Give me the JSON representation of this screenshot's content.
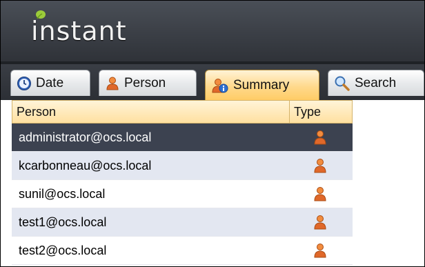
{
  "app": {
    "logo_text": "instant"
  },
  "tabs": [
    {
      "label": "Date",
      "icon": "clock-icon"
    },
    {
      "label": "Person",
      "icon": "person-icon"
    },
    {
      "label": "Summary",
      "icon": "summary-person-info-icon",
      "active": true
    },
    {
      "label": "Search",
      "icon": "search-icon"
    }
  ],
  "table": {
    "headers": {
      "person": "Person",
      "type": "Type"
    },
    "rows": [
      {
        "person": "administrator@ocs.local",
        "type_icon": "person-icon",
        "selected": true
      },
      {
        "person": "kcarbonneau@ocs.local",
        "type_icon": "person-icon"
      },
      {
        "person": "sunil@ocs.local",
        "type_icon": "person-icon"
      },
      {
        "person": "test1@ocs.local",
        "type_icon": "person-icon"
      },
      {
        "person": "test2@ocs.local",
        "type_icon": "person-icon"
      }
    ]
  },
  "colors": {
    "header_bg": "#3a3e45",
    "active_tab": "#ffcc66",
    "selected_row": "#3c4250",
    "alt_row": "#e3e7f1",
    "person_icon": "#e0682a"
  }
}
